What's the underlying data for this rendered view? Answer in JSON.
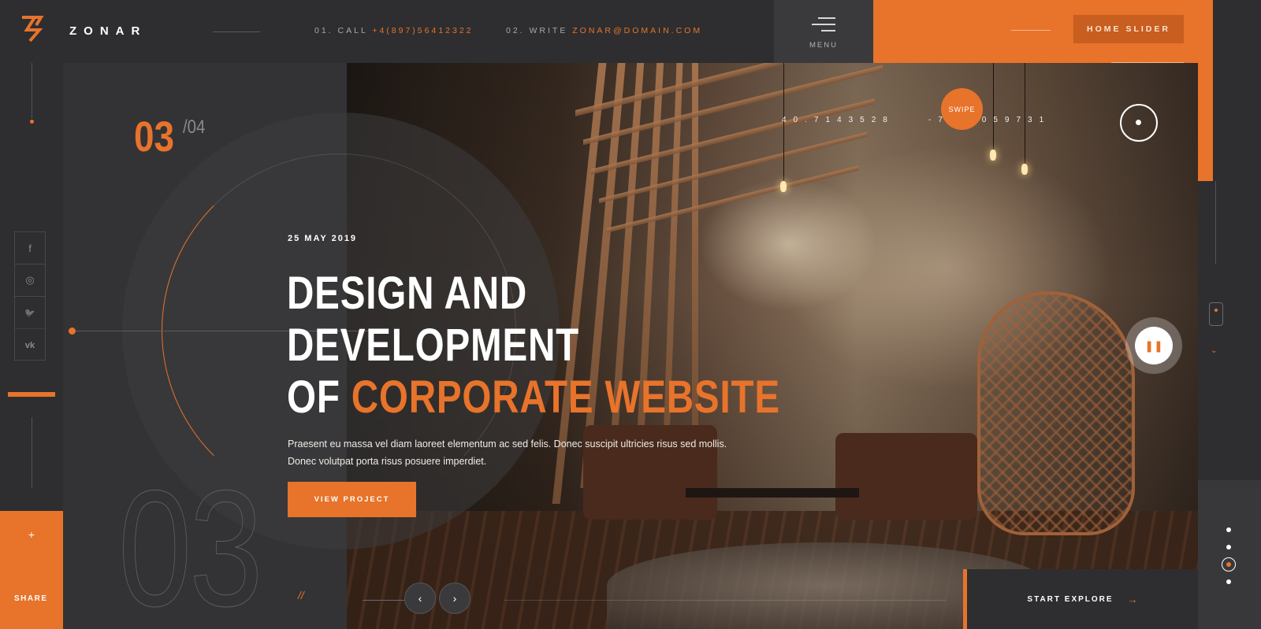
{
  "header": {
    "brand": "ZONAR",
    "call_prefix": "01. CALL",
    "call_number": "+4(897)56412322",
    "write_prefix": "02. WRITE",
    "write_email": "ZONAR@DOMAIN.COM",
    "menu_label": "MENU",
    "home_slider_label": "HOME SLIDER"
  },
  "sidebar": {
    "social": [
      {
        "name": "facebook",
        "glyph": "f"
      },
      {
        "name": "instagram",
        "glyph": "◎"
      },
      {
        "name": "twitter",
        "glyph": "🐦"
      },
      {
        "name": "vk",
        "glyph": "vk"
      }
    ],
    "share_plus": "+",
    "share_label": "SHARE"
  },
  "slide": {
    "current": "03",
    "total": "/04",
    "big_number": "03",
    "slash": "//",
    "date": "25 MAY 2019",
    "headline_line1": "DESIGN AND",
    "headline_line2": "DEVELOPMENT",
    "headline_line3_prefix": "OF",
    "headline_line3_accent": "CORPORATE WEBSITE",
    "description": "Praesent eu massa vel diam laoreet elementum ac sed felis. Donec suscipit ultricies risus sed mollis. Donec volutpat porta risus posuere imperdiet.",
    "cta_label": "VIEW PROJECT",
    "prev_label": "‹",
    "next_label": "›"
  },
  "map": {
    "lat": "40.7143528",
    "lng": "-74.0059731",
    "swipe_label": "SWIPE"
  },
  "controls": {
    "pause_glyph": "❚❚",
    "chevron": "⌄",
    "explore_label": "START EXPLORE",
    "explore_arrow": "→"
  },
  "colors": {
    "accent": "#e8732b",
    "dark": "#2e2e30",
    "panel": "#333335"
  }
}
